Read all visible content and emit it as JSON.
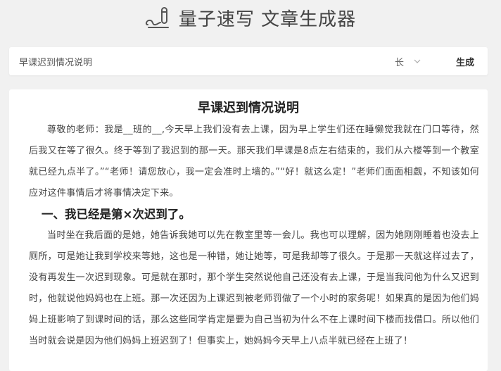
{
  "app": {
    "title": "量子速写 文章生成器",
    "logo_icon": "pen-write-icon"
  },
  "search": {
    "topic_value": "早课迟到情况说明",
    "length_value": "长",
    "length_chevron_icon": "chevron-down-icon",
    "generate_label": "生成"
  },
  "article": {
    "title": "早课迟到情况说明",
    "paragraphs": [
      "尊敬的老师：我是__班的__,今天早上我们没有去上课，因为早上学生们还在睡懒觉我就在门口等待，然后我又在等了很久。终于等到了我迟到的那一天。那天我们早课是8点左右结束的，我们从六楼等到一个教室就已经九点半了。”“老师！请您放心，我一定会准时上墙的。”“好！就这么定！”老师们面面相觑，不知该如何应对这件事情后才将事情决定下来。",
      "当时坐在我后面的是她，她告诉我她可以先在教室里等一会儿。我也可以理解，因为她刚刚睡着也没去上厕所，可是她让我到学校来等她，这也是一种错，她让她等，可是我却等了很久。于是那一天就这样过去了，没有再发生一次迟到现象。可是就在那时，那个学生突然说他自己还没有去上课，于是当我问他为什么又迟到时，他就说他妈妈也在上班。那一次还因为上课迟到被老师罚做了一个小时的家务呢！如果真的是因为他们妈妈上班影响了到课时间的话，那么这些同学肯定是要为自己当初为什么不在上课时间下楼而找借口。所以他们当时就会说是因为他们妈妈上班迟到了！但事实上，她妈妈今天早上八点半就已经在上班了！"
    ],
    "section_heading": "一、我已经是第×次迟到了。"
  },
  "colors": {
    "background": "#f1f1f1",
    "card": "#ffffff",
    "text": "#444444",
    "heading": "#222222"
  }
}
